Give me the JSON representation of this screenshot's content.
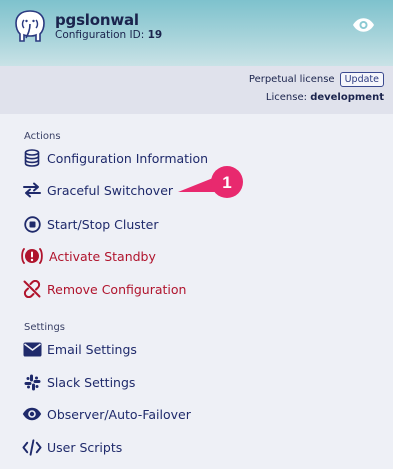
{
  "header": {
    "app_name": "pgslonwal",
    "config_id_label": "Configuration ID:",
    "config_id_value": "19",
    "logo_icon": "postgres-elephant-icon",
    "visibility_icon": "eye-icon"
  },
  "license": {
    "type_label": "Perpetual license",
    "update_label": "Update",
    "license_label": "License:",
    "license_value": "development"
  },
  "actions": {
    "title": "Actions",
    "items": [
      {
        "label": "Configuration Information",
        "icon": "database-icon"
      },
      {
        "label": "Graceful Switchover",
        "icon": "switch-arrows-icon"
      },
      {
        "label": "Start/Stop Cluster",
        "icon": "stop-circle-icon"
      },
      {
        "label": "Activate Standby",
        "icon": "alert-icon"
      },
      {
        "label": "Remove Configuration",
        "icon": "unlink-icon"
      }
    ]
  },
  "settings": {
    "title": "Settings",
    "items": [
      {
        "label": "Email Settings",
        "icon": "envelope-icon"
      },
      {
        "label": "Slack Settings",
        "icon": "slack-icon"
      },
      {
        "label": "Observer/Auto-Failover",
        "icon": "eye-icon"
      },
      {
        "label": "User Scripts",
        "icon": "code-icon"
      }
    ]
  },
  "callout": {
    "number": "1"
  },
  "colors": {
    "accent": "#1f2a6b",
    "danger": "#b0142d",
    "callout": "#e8296e"
  }
}
